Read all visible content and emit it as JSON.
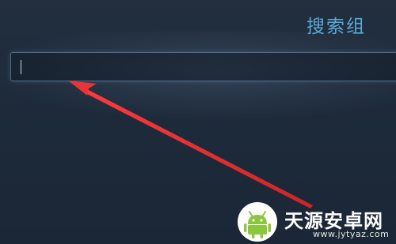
{
  "header": {
    "title": "搜索组"
  },
  "search": {
    "value": "",
    "placeholder": ""
  },
  "annotation": {
    "arrow_color": "#e8353a"
  },
  "watermark": {
    "name": "天源安卓网",
    "url": "www.jytyaz.com",
    "icon": "android-logo-icon"
  },
  "colors": {
    "background": "#1b2838",
    "title": "#5aa9d6",
    "input_border": "#4d6a86",
    "logo_green": "#8cc63f"
  }
}
